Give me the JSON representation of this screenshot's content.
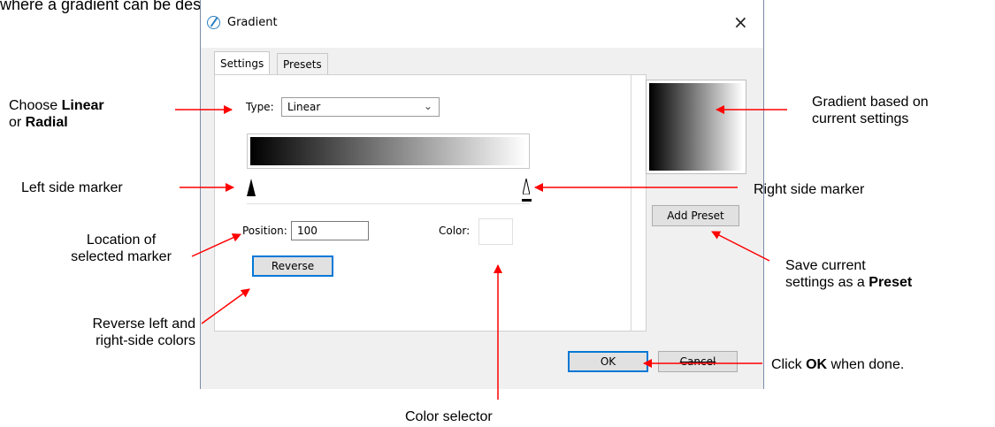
{
  "intro_text": "where a gradient can be designed.",
  "dialog": {
    "title": "Gradient",
    "close_glyph": "×",
    "tabs": [
      {
        "label": "Settings",
        "active": true
      },
      {
        "label": "Presets",
        "active": false
      }
    ],
    "type_label": "Type:",
    "type_value": "Linear",
    "position_label": "Position:",
    "position_value": "100",
    "color_label": "Color:",
    "reverse_label": "Reverse",
    "add_preset_label": "Add Preset",
    "ok_label": "OK",
    "cancel_label": "Cancel",
    "gradient": {
      "start_color": "#000000",
      "end_color": "#ffffff"
    }
  },
  "annotations": {
    "choose_type": {
      "prefix": "Choose ",
      "bold1": "Linear",
      "line2_prefix": "or ",
      "bold2": "Radial"
    },
    "left_marker": "Left side marker",
    "location": [
      "Location of",
      "selected marker"
    ],
    "reverse_colors": [
      "Reverse left and",
      "right-side colors"
    ],
    "color_selector": "Color selector",
    "gradient_based": [
      "Gradient based on",
      "current settings"
    ],
    "right_marker": "Right side marker",
    "save_preset": {
      "line1": "Save current",
      "line2_prefix": "settings as a ",
      "bold": "Preset"
    },
    "click_ok": {
      "prefix": "Click ",
      "bold": "OK",
      "suffix": " when done."
    }
  },
  "colors": {
    "arrow": "#ff0000",
    "focus_border": "#0078d7"
  },
  "icons": {
    "title": "gradient-app-icon",
    "close": "close-icon",
    "dropdown": "chevron-down-icon"
  }
}
